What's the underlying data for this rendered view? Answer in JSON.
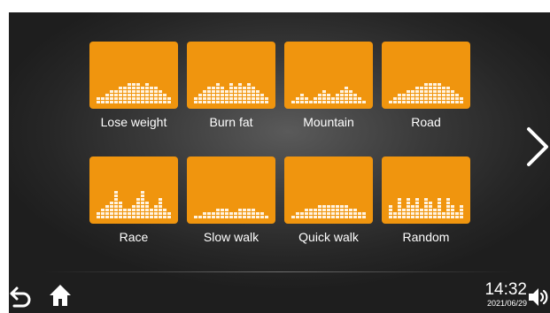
{
  "programs": [
    {
      "label": "Lose weight",
      "levels": [
        2,
        2,
        3,
        4,
        4,
        5,
        5,
        6,
        6,
        6,
        5,
        6,
        5,
        5,
        4,
        3,
        2
      ]
    },
    {
      "label": "Burn fat",
      "levels": [
        2,
        3,
        4,
        5,
        5,
        6,
        5,
        4,
        6,
        5,
        6,
        5,
        6,
        5,
        4,
        3,
        2
      ]
    },
    {
      "label": "Mountain",
      "levels": [
        1,
        2,
        3,
        2,
        1,
        2,
        3,
        4,
        3,
        2,
        3,
        4,
        5,
        4,
        3,
        2,
        1
      ]
    },
    {
      "label": "Road",
      "levels": [
        1,
        2,
        3,
        3,
        4,
        4,
        5,
        5,
        6,
        6,
        6,
        6,
        5,
        5,
        4,
        3,
        2
      ]
    },
    {
      "label": "Race",
      "levels": [
        2,
        3,
        4,
        5,
        8,
        5,
        3,
        3,
        4,
        6,
        8,
        5,
        3,
        4,
        6,
        3,
        2
      ]
    },
    {
      "label": "Slow walk",
      "levels": [
        1,
        1,
        2,
        2,
        2,
        3,
        3,
        3,
        2,
        2,
        3,
        3,
        3,
        3,
        2,
        2,
        1
      ]
    },
    {
      "label": "Quick walk",
      "levels": [
        1,
        2,
        2,
        3,
        3,
        3,
        4,
        4,
        4,
        4,
        4,
        4,
        4,
        3,
        3,
        2,
        2
      ]
    },
    {
      "label": "Random",
      "levels": [
        4,
        2,
        6,
        3,
        6,
        4,
        6,
        3,
        6,
        5,
        3,
        6,
        2,
        6,
        4,
        2,
        4
      ]
    }
  ],
  "clock": {
    "time": "14:32",
    "date": "2021/06/29"
  },
  "icons": {
    "next": "chevron-right-icon",
    "back": "back-arrow-icon",
    "home": "home-icon",
    "volume": "speaker-icon"
  },
  "colors": {
    "tile": "#f0950e",
    "bar": "#fff3e0",
    "text": "#ffffff",
    "background": "#2e2e2e"
  }
}
